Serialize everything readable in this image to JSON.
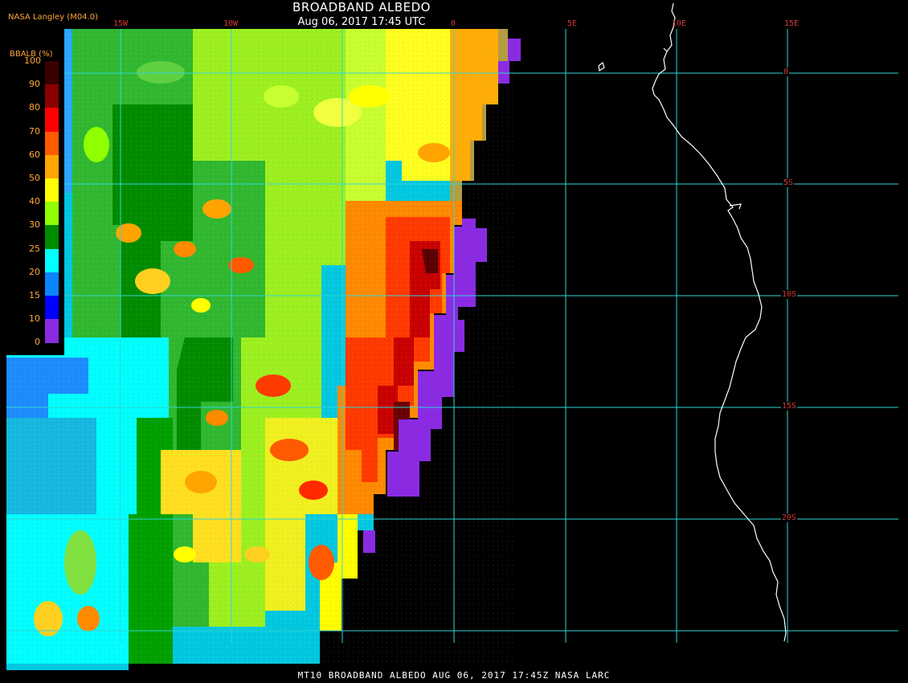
{
  "header": {
    "title": "BROADBAND ALBEDO",
    "subtitle": "Aug 06, 2017 17:45 UTC",
    "source": "NASA Langley (M04.0)"
  },
  "footer": "MT10  BROADBAND ALBEDO  AUG 06, 2017 17:45Z  NASA LARC",
  "legend": {
    "title": "BBALB (%)",
    "ticks": [
      "100",
      "90",
      "80",
      "70",
      "60",
      "50",
      "40",
      "30",
      "25",
      "20",
      "15",
      "10",
      "0"
    ],
    "colors": [
      "#3a0000",
      "#8a0000",
      "#ff0000",
      "#ff5a00",
      "#ffa400",
      "#ffff00",
      "#90ff00",
      "#008c00",
      "#00ffff",
      "#0a84ff",
      "#0000ff",
      "#8a2be2"
    ]
  },
  "grid": {
    "lon_labels": [
      "15W",
      "10W",
      "0",
      "5E",
      "10E",
      "15E"
    ],
    "lat_labels": [
      "0",
      "5S",
      "10S",
      "15S",
      "20S"
    ]
  },
  "colors": {
    "background": "#000000",
    "gridline": "#2fd6d6",
    "coastline": "#ffffff",
    "grid_label": "#d43a3a",
    "legend_text": "#ffa63a"
  }
}
